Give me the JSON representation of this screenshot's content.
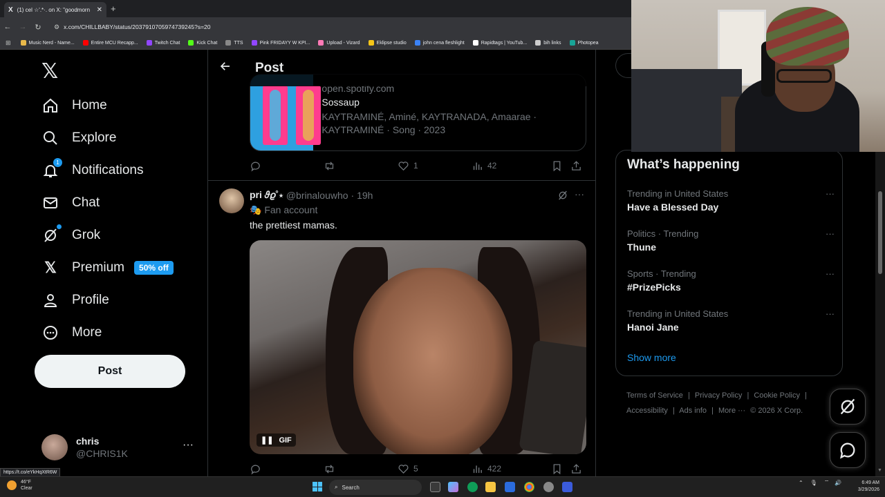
{
  "browser": {
    "tab_title": "(1) cel ☆'.*·. on X: \"goodmorn",
    "tab_close": "✕",
    "new_tab": "+",
    "url": "x.com/CHILLBABY/status/2037910705974739245?s=20",
    "bookmarks": [
      {
        "label": "Music Nerd - Name...",
        "color": "#e8b84a"
      },
      {
        "label": "Entire MCU Recapp...",
        "color": "#ff0000"
      },
      {
        "label": "Twitch Chat",
        "color": "#9146ff"
      },
      {
        "label": "Kick Chat",
        "color": "#53fc18"
      },
      {
        "label": "TTS",
        "color": "#888888"
      },
      {
        "label": "Pink FRIDAYY W KPI...",
        "color": "#9146ff"
      },
      {
        "label": "Upload - Vizard",
        "color": "#ff7ab6"
      },
      {
        "label": "Eklipse studio",
        "color": "#f5c518"
      },
      {
        "label": "john cena fleshlight",
        "color": "#3b82f6"
      },
      {
        "label": "Rapidtags | YouTub...",
        "color": "#ffffff"
      },
      {
        "label": "bih links",
        "color": "#cccccc"
      },
      {
        "label": "Photopea",
        "color": "#18a497"
      }
    ],
    "status_url": "https://t.co/eYkHqXtR6W"
  },
  "leftnav": {
    "logo": "𝕏",
    "items": [
      {
        "label": "Home",
        "icon": "home-icon"
      },
      {
        "label": "Explore",
        "icon": "search-icon"
      },
      {
        "label": "Notifications",
        "icon": "bell-icon",
        "badge": "1"
      },
      {
        "label": "Chat",
        "icon": "mail-icon"
      },
      {
        "label": "Grok",
        "icon": "grok-icon"
      },
      {
        "label": "Premium",
        "icon": "x-icon",
        "badge": "50% off"
      },
      {
        "label": "Profile",
        "icon": "person-icon"
      },
      {
        "label": "More",
        "icon": "more-circle-icon"
      }
    ],
    "post_button": "Post",
    "account": {
      "name": "chris",
      "handle": "@CHRIS1K",
      "more": "···"
    }
  },
  "center": {
    "header_title": "Post",
    "spotify_card": {
      "domain": "open.spotify.com",
      "title": "Sossaup",
      "description": "KAYTRAMINÉ, Aminé, KAYTRANADA, Amaarae · KAYTRAMINÉ · Song · 2023"
    },
    "tweet1_actions": {
      "likes": "1",
      "views": "42"
    },
    "tweet2": {
      "display_name": "pri 𝜗𝜚˚⋆",
      "handle": "@brinalouwho",
      "time": "· 19h",
      "label": "🎭 Fan account",
      "text": "the prettiest mamas.",
      "gif_label": "GIF",
      "likes": "5",
      "views": "422"
    }
  },
  "right": {
    "trends_title": "What’s happening",
    "trends": [
      {
        "context": "Trending in United States",
        "name": "Have a Blessed Day"
      },
      {
        "context": "Politics · Trending",
        "name": "Thune"
      },
      {
        "context": "Sports · Trending",
        "name": "#PrizePicks"
      },
      {
        "context": "Trending in United States",
        "name": "Hanoi Jane"
      }
    ],
    "trend_more": "···",
    "show_more": "Show more",
    "footer": [
      "Terms of Service",
      "|",
      "Privacy Policy",
      "|",
      "Cookie Policy",
      "|",
      "Accessibility",
      "|",
      "Ads info",
      "|",
      "More ···",
      "© 2026 X Corp."
    ]
  },
  "taskbar": {
    "weather_temp": "46°F",
    "weather_desc": "Clear",
    "search": "Search",
    "time": "6:49 AM",
    "date": "3/29/2026"
  },
  "colors": {
    "accent": "#1d9bf0",
    "background": "#000000",
    "muted": "#71767b"
  }
}
